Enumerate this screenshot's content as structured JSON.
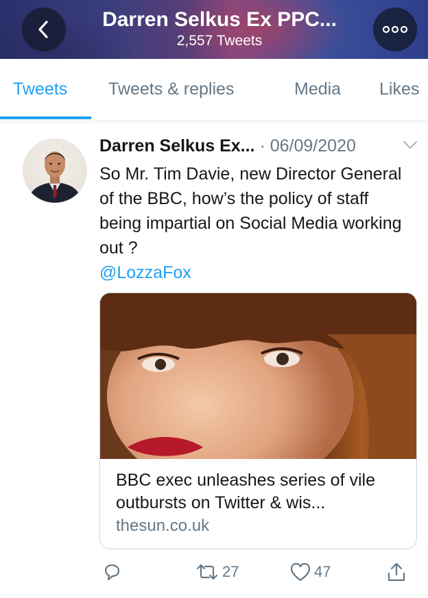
{
  "header": {
    "title": "Darren Selkus Ex PPC...",
    "tweet_count": "2,557 Tweets",
    "back_icon": "chevron-left-icon",
    "more_icon": "more-icon"
  },
  "tabs": [
    {
      "label": "Tweets",
      "active": true
    },
    {
      "label": "Tweets & replies",
      "active": false
    },
    {
      "label": "Media",
      "active": false
    },
    {
      "label": "Likes",
      "active": false
    }
  ],
  "tweet": {
    "author_name": "Darren Selkus Ex...",
    "separator": "·",
    "date": "06/09/2020",
    "text": "So Mr. Tim Davie, new Director General of the BBC, how’s the policy of staff being impartial on Social Media working out ?",
    "mention": "@LozzaFox",
    "card": {
      "title": "BBC exec unleashes series of vile outbursts on Twitter & wis...",
      "domain": "thesun.co.uk"
    },
    "actions": {
      "reply_icon": "reply-icon",
      "retweet_icon": "retweet-icon",
      "retweet_count": "27",
      "like_icon": "heart-icon",
      "like_count": "47",
      "share_icon": "share-icon"
    }
  },
  "colors": {
    "accent": "#1da1f2",
    "secondary_text": "#657786",
    "primary_text": "#14171a"
  }
}
